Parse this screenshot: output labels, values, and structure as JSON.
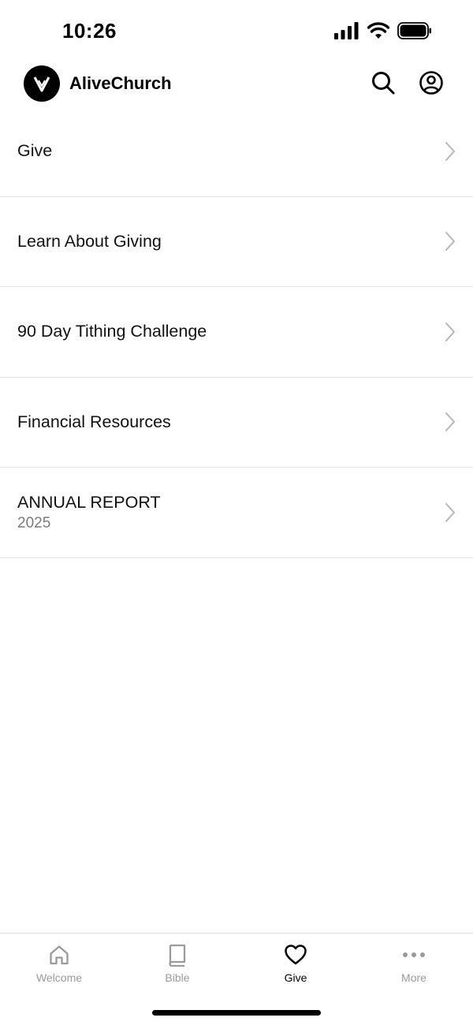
{
  "status_bar": {
    "time": "10:26"
  },
  "header": {
    "brand_name": "AliveChurch",
    "logo_icon": "v-logo-icon",
    "search_icon": "search-icon",
    "profile_icon": "profile-icon"
  },
  "menu": {
    "items": [
      {
        "title": "Give",
        "subtitle": ""
      },
      {
        "title": "Learn About Giving",
        "subtitle": ""
      },
      {
        "title": "90 Day Tithing Challenge",
        "subtitle": ""
      },
      {
        "title": "Financial Resources",
        "subtitle": ""
      },
      {
        "title": "ANNUAL REPORT",
        "subtitle": "2025"
      }
    ]
  },
  "tab_bar": {
    "tabs": [
      {
        "label": "Welcome",
        "icon": "home-icon",
        "active": false
      },
      {
        "label": "Bible",
        "icon": "book-icon",
        "active": false
      },
      {
        "label": "Give",
        "icon": "heart-icon",
        "active": true
      },
      {
        "label": "More",
        "icon": "more-dots-icon",
        "active": false
      }
    ]
  },
  "colors": {
    "text": "#111111",
    "secondary_text": "#7a7a7a",
    "inactive_tab": "#9a9a9a",
    "divider": "#e4e4e4",
    "background": "#ffffff"
  }
}
